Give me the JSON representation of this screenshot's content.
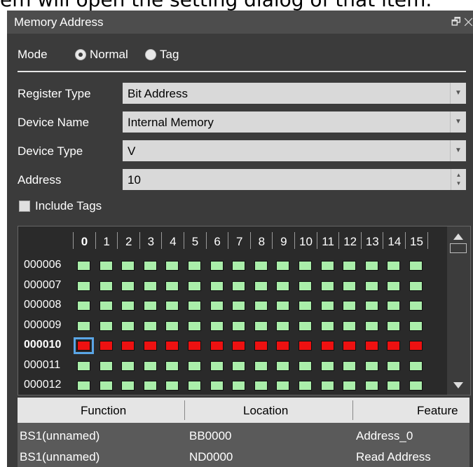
{
  "caption": "em will open the setting dialog of that item.",
  "window": {
    "title": "Memory Address",
    "controls": "🗗 ✕"
  },
  "mode": {
    "label": "Mode",
    "options": [
      {
        "label": "Normal",
        "selected": true
      },
      {
        "label": "Tag",
        "selected": false
      }
    ]
  },
  "fields": {
    "register_type": {
      "label": "Register Type",
      "value": "Bit Address"
    },
    "device_name": {
      "label": "Device Name",
      "value": "Internal Memory"
    },
    "device_type": {
      "label": "Device Type",
      "value": "V"
    },
    "address": {
      "label": "Address",
      "value": "10"
    }
  },
  "include_tags": {
    "label": "Include Tags",
    "checked": false
  },
  "bit_grid": {
    "columns": [
      "0",
      "1",
      "2",
      "3",
      "4",
      "5",
      "6",
      "7",
      "8",
      "9",
      "10",
      "11",
      "12",
      "13",
      "14",
      "15"
    ],
    "rows": [
      {
        "address": "000006",
        "state": "off"
      },
      {
        "address": "000007",
        "state": "off"
      },
      {
        "address": "000008",
        "state": "off"
      },
      {
        "address": "000009",
        "state": "off"
      },
      {
        "address": "000010",
        "state": "on",
        "current": true
      },
      {
        "address": "000011",
        "state": "off"
      },
      {
        "address": "000012",
        "state": "off"
      }
    ],
    "colors": {
      "off": "#aaeeaa",
      "on": "#ee1111",
      "selected": "#5aa6e6"
    },
    "selected_bit": "0"
  },
  "table": {
    "headers": [
      "Function",
      "Location",
      "Feature"
    ],
    "rows": [
      [
        "BS1(unnamed)",
        "BB0000",
        "Address_0"
      ],
      [
        "BS1(unnamed)",
        "ND0000",
        "Read Address"
      ]
    ]
  }
}
